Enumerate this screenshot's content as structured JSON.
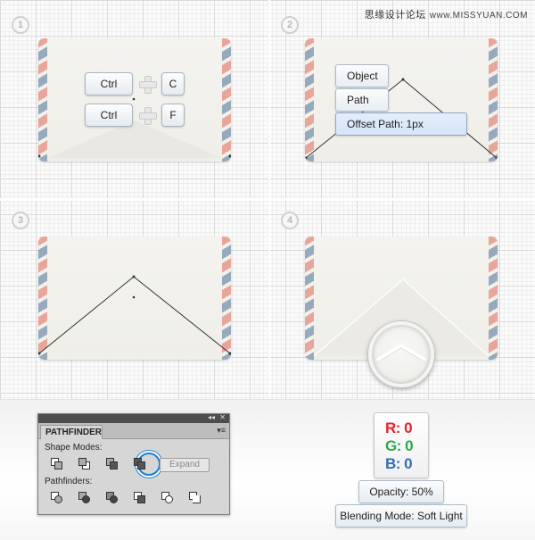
{
  "watermark": {
    "text": "思缘设计论坛",
    "site": "www.MISSYUAN.COM"
  },
  "steps": [
    "1",
    "2",
    "3",
    "4"
  ],
  "step1": {
    "key_ctrl_1": "Ctrl",
    "key_c": "C",
    "key_ctrl_2": "Ctrl",
    "key_f": "F"
  },
  "step2": {
    "menu_object": "Object",
    "menu_path": "Path",
    "menu_offset_path": "Offset Path: 1px"
  },
  "pathfinder": {
    "title": "PATHFINDER",
    "shape_modes_label": "Shape Modes:",
    "pathfinders_label": "Pathfinders:",
    "expand_label": "Expand",
    "collapse_glyph": "◂◂",
    "close_glyph": "✕",
    "menu_glyph": "▾≡"
  },
  "color": {
    "r_label": "R: 0",
    "g_label": "G: 0",
    "b_label": "B: 0",
    "r_color": "#e8212b",
    "g_color": "#2aa84a",
    "b_color": "#2f6fb6"
  },
  "opacity_label": "Opacity: 50%",
  "blending_label": "Blending Mode: Soft Light"
}
